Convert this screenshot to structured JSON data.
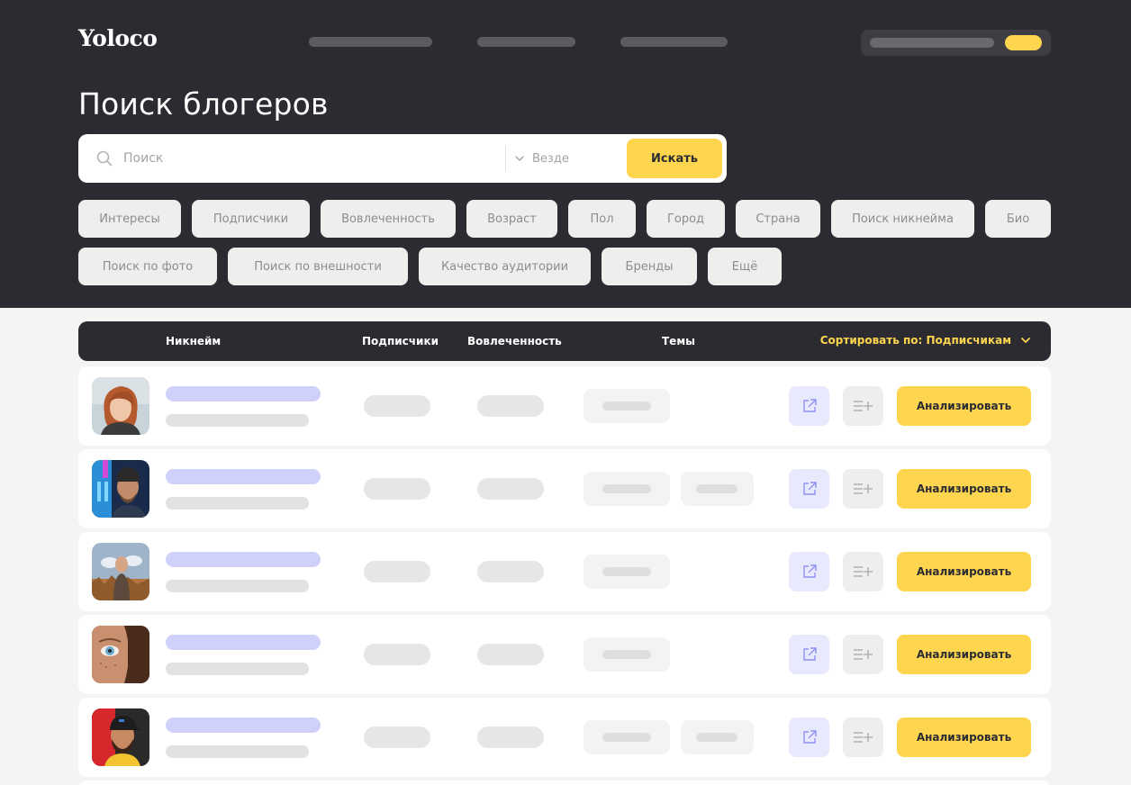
{
  "header": {
    "logo": "Yoloco",
    "page_title": "Поиск блогеров"
  },
  "search": {
    "placeholder": "Поиск",
    "scope_value": "Везде",
    "submit_label": "Искать"
  },
  "filters": [
    "Интересы",
    "Подписчики",
    "Вовлеченность",
    "Возраст",
    "Пол",
    "Город",
    "Страна",
    "Поиск никнейма",
    "Био",
    "Поиск по фото",
    "Поиск по внешности",
    "Качество аудитории",
    "Бренды",
    "Ещё"
  ],
  "table": {
    "columns": {
      "nickname": "Никнейм",
      "subscribers": "Подписчики",
      "engagement": "Вовлеченность",
      "topics": "Темы"
    },
    "sort_label": "Сортировать по: Подписчикам",
    "analyze_label": "Анализировать"
  },
  "colors": {
    "dark": "#2c2b31",
    "accent": "#fdd54f",
    "name_placeholder": "#cfd1fb"
  },
  "icons": {
    "search": "search-icon",
    "scope": "chevron-down-icon",
    "open": "external-link-icon",
    "add_to_list": "add-to-list-icon"
  }
}
